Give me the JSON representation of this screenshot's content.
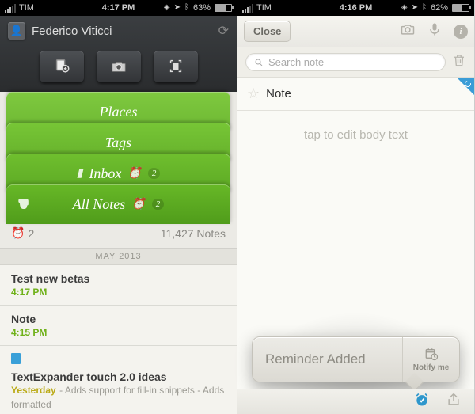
{
  "left": {
    "status": {
      "carrier": "TIM",
      "time": "4:17 PM",
      "battery_pct": "63%"
    },
    "user_name": "Federico Viticci",
    "tabs": {
      "places": "Places",
      "tags": "Tags",
      "inbox": "Inbox",
      "inbox_badge": "2",
      "all": "All Notes",
      "all_badge": "2"
    },
    "summary": {
      "reminder_count": "2",
      "note_count": "11,427 Notes"
    },
    "section": "MAY 2013",
    "notes": [
      {
        "title": "Test new betas",
        "meta": "4:17 PM"
      },
      {
        "title": "Note",
        "meta": "4:15 PM"
      },
      {
        "title": "TextExpander touch 2.0 ideas",
        "meta": "Yesterday",
        "snippet": " - Adds support for fill-in snippets - Adds formatted"
      }
    ]
  },
  "right": {
    "status": {
      "carrier": "TIM",
      "time": "4:16 PM",
      "battery_pct": "62%"
    },
    "close_label": "Close",
    "search_placeholder": "Search note",
    "note_title": "Note",
    "body_placeholder": "tap to edit body text",
    "popover": {
      "message": "Reminder Added",
      "notify_label": "Notify me"
    }
  }
}
